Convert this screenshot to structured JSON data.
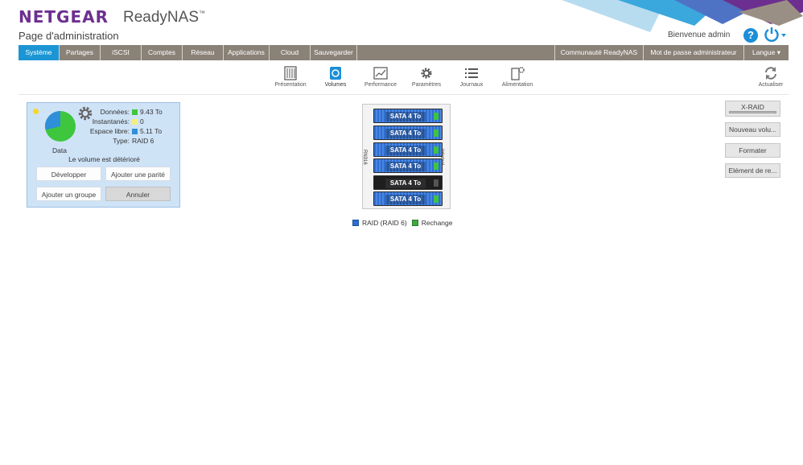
{
  "header": {
    "brand": "NETGEAR",
    "product": "ReadyNAS",
    "product_tm": "™",
    "subtitle": "Page d'administration",
    "welcome": "Bienvenue admin",
    "help_glyph": "?"
  },
  "nav": {
    "tabs": [
      {
        "label": "Système",
        "active": true
      },
      {
        "label": "Partages"
      },
      {
        "label": "iSCSI"
      },
      {
        "label": "Comptes"
      },
      {
        "label": "Réseau"
      },
      {
        "label": "Applications"
      },
      {
        "label": "Cloud"
      },
      {
        "label": "Sauvegarder"
      }
    ],
    "right": [
      "Communauté ReadyNAS",
      "Mot de passe administrateur",
      "Langue"
    ]
  },
  "subtools": {
    "items": [
      {
        "label": "Présentation",
        "icon": "overview-icon"
      },
      {
        "label": "Volumes",
        "icon": "volumes-icon",
        "active": true
      },
      {
        "label": "Performance",
        "icon": "performance-icon"
      },
      {
        "label": "Paramètres",
        "icon": "settings-icon"
      },
      {
        "label": "Journaux",
        "icon": "logs-icon"
      },
      {
        "label": "Alimentation",
        "icon": "power-settings-icon"
      }
    ],
    "refresh": "Actualiser"
  },
  "volume": {
    "name": "Data",
    "status": "Le volume est détérioré",
    "stats": [
      {
        "key": "Données:",
        "value": "9.43 To",
        "color": "#3ec63e"
      },
      {
        "key": "Instantanés:",
        "value": "0",
        "color": "#f2ef80"
      },
      {
        "key": "Espace libre:",
        "value": "5.11 To",
        "color": "#2f8fd8"
      },
      {
        "key": "Type:",
        "value": "RAID 6"
      }
    ],
    "buttons": {
      "expand": "Développer",
      "add_parity": "Ajouter une parité",
      "add_group": "Ajouter un groupe",
      "cancel": "Annuler"
    }
  },
  "chassis": {
    "model": "RN316",
    "side_label": "Internal",
    "bays": [
      {
        "label": "SATA 4 To",
        "state": "raid"
      },
      {
        "label": "SATA 4 To",
        "state": "raid"
      },
      {
        "label": "SATA 4 To",
        "state": "raid"
      },
      {
        "label": "SATA 4 To",
        "state": "raid"
      },
      {
        "label": "SATA 4 To",
        "state": "empty"
      },
      {
        "label": "SATA 4 To",
        "state": "raid"
      }
    ]
  },
  "legend": {
    "raid": "RAID (RAID 6)",
    "spare": "Rechange",
    "raid_color": "#2a6fd0",
    "spare_color": "#3fa83f"
  },
  "actions": {
    "xraid": "X-RAID",
    "new_volume": "Nouveau volu...",
    "format": "Formater",
    "element": "Elément de re..."
  }
}
